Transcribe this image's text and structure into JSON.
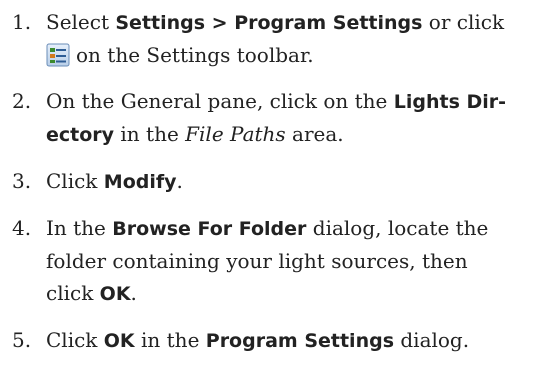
{
  "steps": [
    {
      "num": "1.",
      "t1": "Select ",
      "b1": "Settings > Program Settings",
      "t2": " or click",
      "icon": "program-settings-icon",
      "t3": "on the Settings toolbar."
    },
    {
      "num": "2.",
      "t1": "On the General pane, click on the ",
      "b1a": "Lights Dir-",
      "b1b": "ectory",
      "t2": " in the ",
      "i1": "File Paths",
      "t3": " area."
    },
    {
      "num": "3.",
      "t1": "Click ",
      "b1": "Modify",
      "t2": "."
    },
    {
      "num": "4.",
      "t1": "In the ",
      "b1": "Browse For Folder",
      "t2": " dialog, locate the",
      "t3": "folder containing your light sources, then",
      "t4": "click ",
      "b2": "OK",
      "t5": "."
    },
    {
      "num": "5.",
      "t1": "Click ",
      "b1": "OK",
      "t2": " in the ",
      "b2": "Program Settings",
      "t3": " dialog."
    }
  ]
}
